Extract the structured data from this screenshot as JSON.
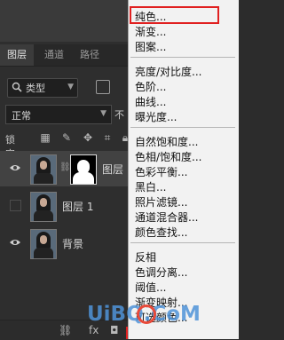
{
  "tabs": [
    "图层",
    "通道",
    "路径"
  ],
  "filter": {
    "kind_label": "类型"
  },
  "blend_mode": "正常",
  "opacity_label": "不",
  "lock_label": "锁定:",
  "layers": [
    {
      "name": "图层 ",
      "visible": true,
      "selected": true,
      "has_mask": true
    },
    {
      "name": "图层 1",
      "visible": false,
      "selected": false,
      "has_mask": false
    },
    {
      "name": "背景",
      "visible": true,
      "selected": false,
      "has_mask": false
    }
  ],
  "menu": {
    "group1": [
      "纯色...",
      "渐变...",
      "图案..."
    ],
    "group2": [
      "亮度/对比度...",
      "色阶...",
      "曲线...",
      "曝光度..."
    ],
    "group3": [
      "自然饱和度...",
      "色相/饱和度...",
      "色彩平衡...",
      "黑白...",
      "照片滤镜...",
      "通道混合器...",
      "颜色查找..."
    ],
    "group4": [
      "反相",
      "色调分离...",
      "阈值...",
      "渐变映射...",
      "可选颜色..."
    ]
  },
  "watermark": "UiBQ.CoM",
  "colors": {
    "highlight_red": "#e02020",
    "menu_bg": "#f2f2f2",
    "panel_bg": "#2e2e2e"
  }
}
